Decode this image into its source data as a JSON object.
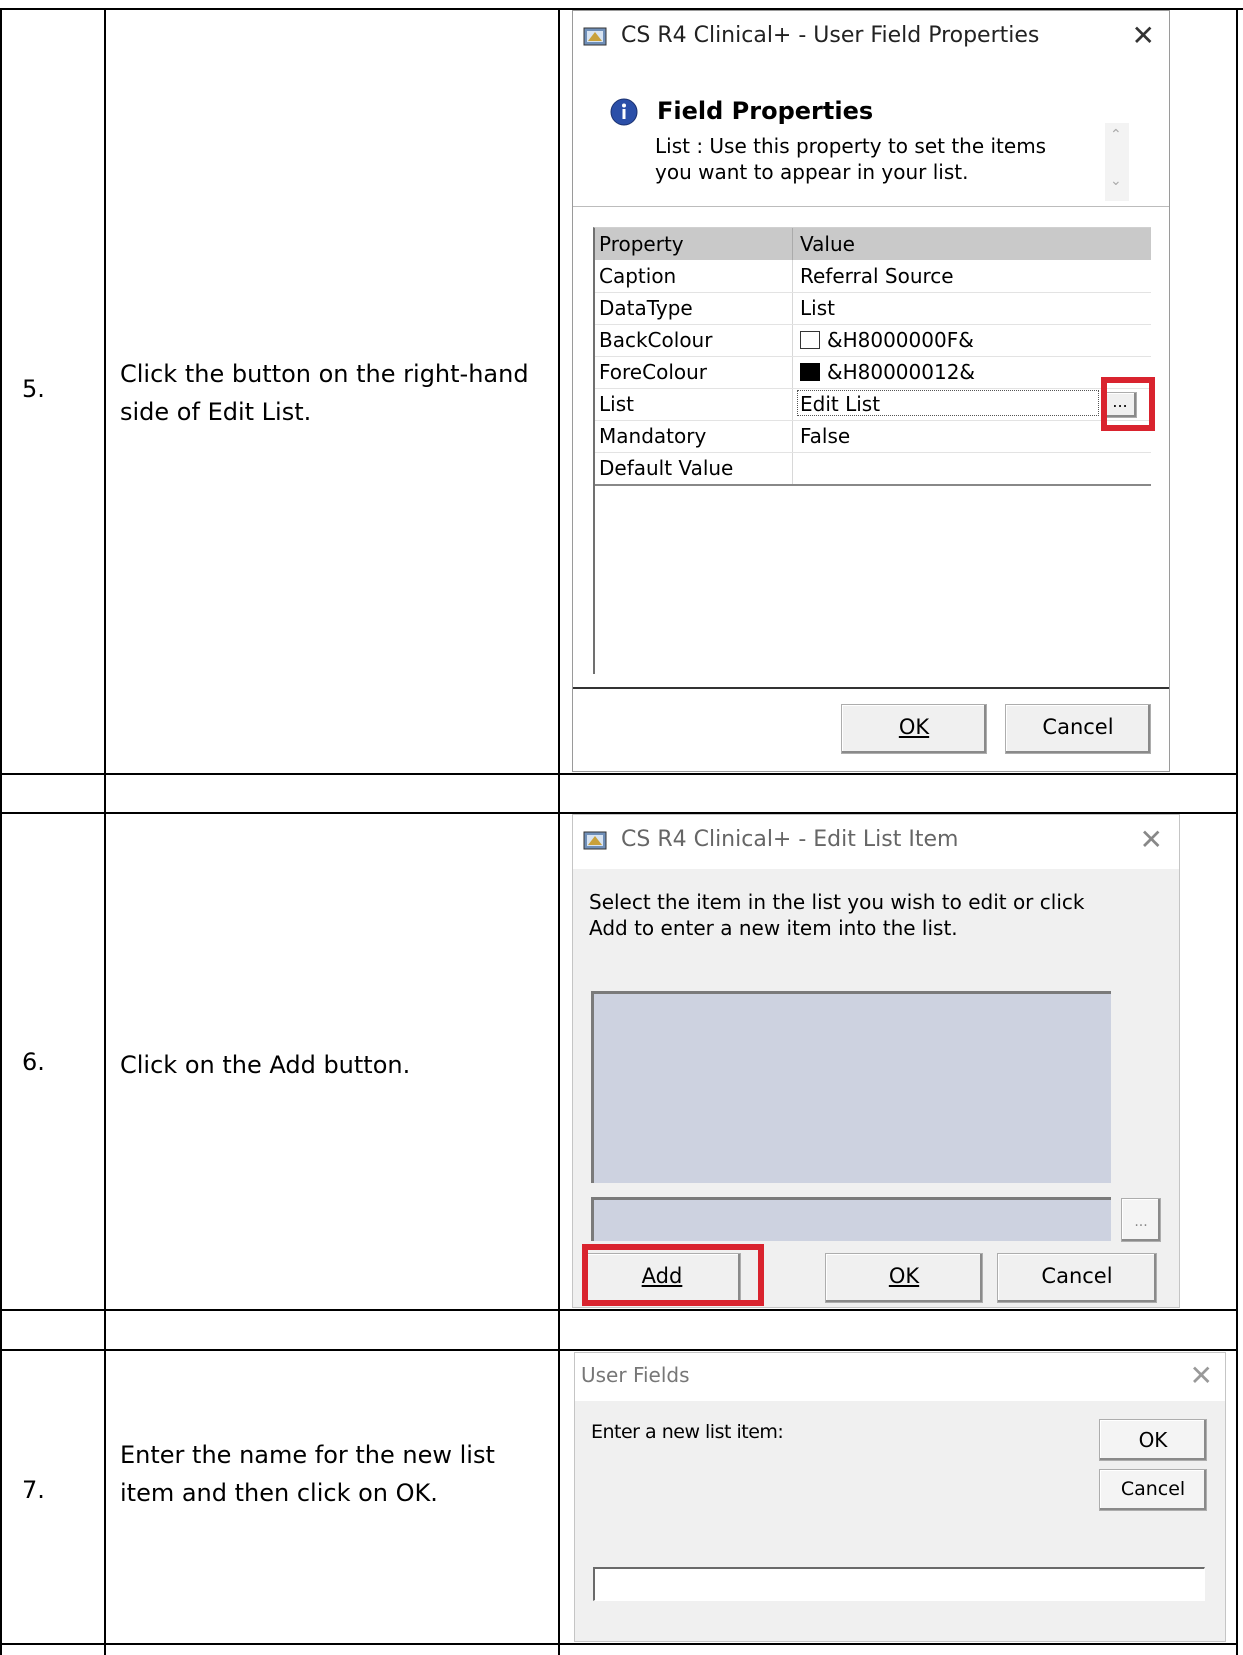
{
  "steps": [
    {
      "number": "5.",
      "text": "Click the button on the right-hand side of Edit List.",
      "dialog": {
        "title": "CS R4 Clinical+ - User Field Properties",
        "close": "✕",
        "heading": "Field Properties",
        "description": "List : Use this property to set the items you want to appear in your list.",
        "columns": [
          "Property",
          "Value"
        ],
        "rows": [
          {
            "property": "Caption",
            "value": "Referral Source"
          },
          {
            "property": "DataType",
            "value": "List"
          },
          {
            "property": "BackColour",
            "value": "&H8000000F&"
          },
          {
            "property": "ForeColour",
            "value": "&H80000012&"
          },
          {
            "property": "List",
            "value": "Edit List"
          },
          {
            "property": "Mandatory",
            "value": "False"
          },
          {
            "property": "Default Value",
            "value": ""
          }
        ],
        "ellipsis": "...",
        "ok": "OK",
        "cancel": "Cancel"
      }
    },
    {
      "number": "6.",
      "text": "Click on the Add button.",
      "dialog": {
        "title": "CS R4 Clinical+ - Edit List Item",
        "close": "✕",
        "instruction": "Select the item in the list you wish to edit or click Add to enter a new item into the list.",
        "ellipsis": "...",
        "add": "Add",
        "ok": "OK",
        "cancel": "Cancel"
      }
    },
    {
      "number": "7.",
      "text": "Enter the name for the new list item and then click on OK.",
      "dialog": {
        "title": "User Fields",
        "close": "✕",
        "prompt": "Enter a new list item:",
        "ok": "OK",
        "cancel": "Cancel",
        "input_value": ""
      }
    }
  ],
  "colors": {
    "highlight": "#d9232e",
    "listbox": "#cdd2e0",
    "info_icon": "#2b4fa8"
  }
}
